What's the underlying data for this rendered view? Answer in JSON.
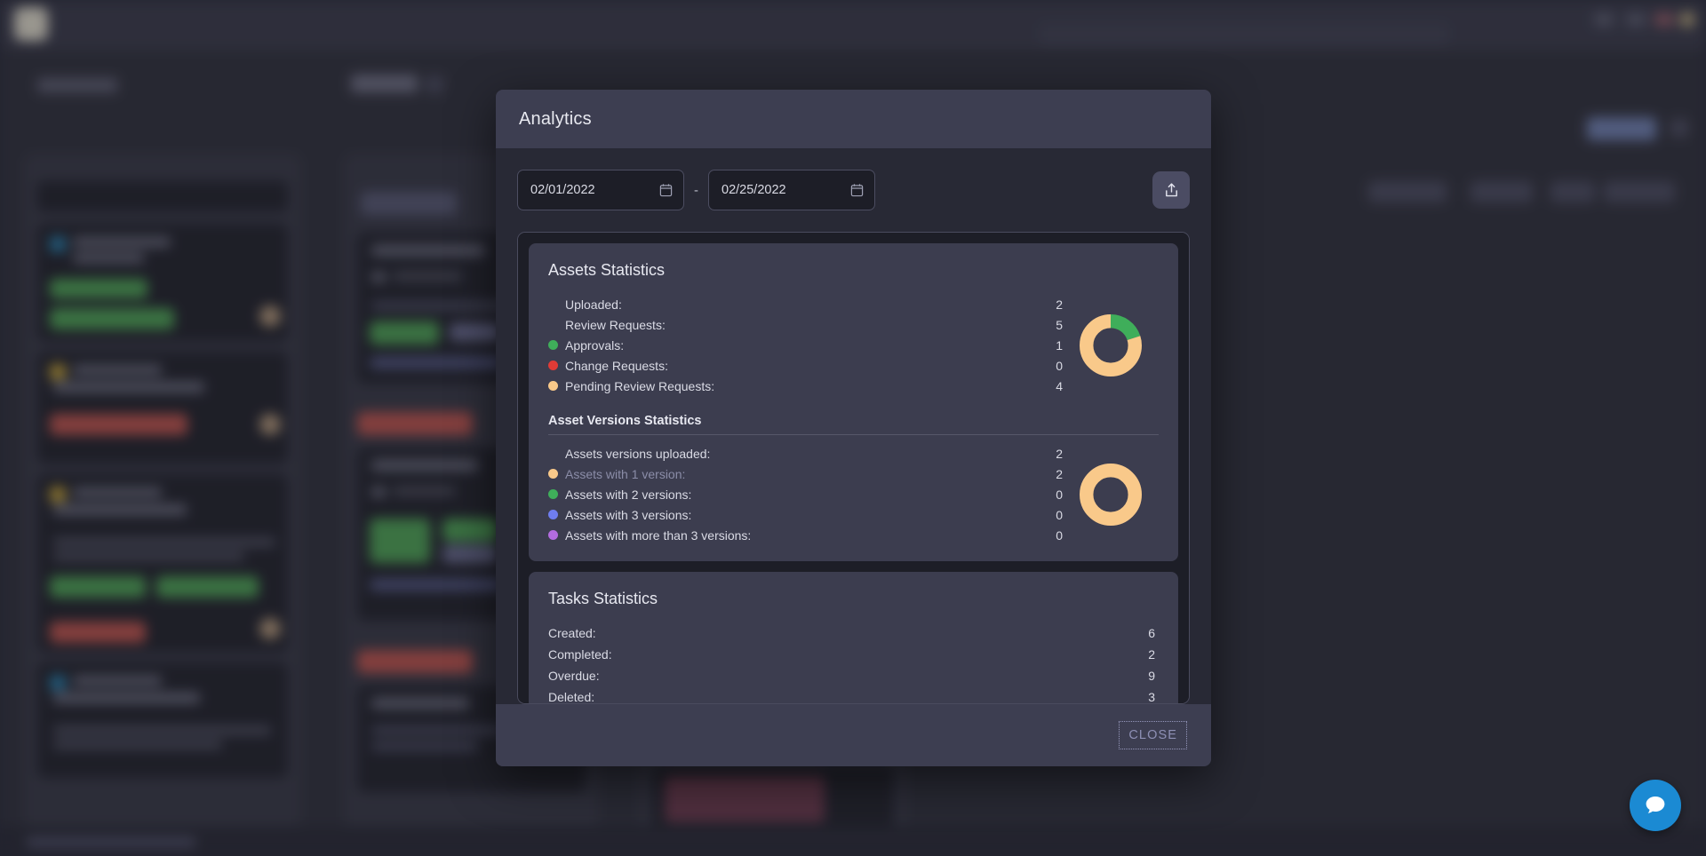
{
  "background": {
    "topbar": {
      "logo_icon": "app-logo-icon",
      "search_placeholder": ""
    },
    "chat_widget": {
      "icon": "chat-bubble-icon",
      "color": "#1b8ad3"
    }
  },
  "modal": {
    "title": "Analytics",
    "date_range": {
      "start_value": "02/01/2022",
      "start_placeholder": "mm/dd/yyyy",
      "end_value": "02/25/2022",
      "end_placeholder": "mm/dd/yyyy",
      "separator": "-",
      "calendar_icon": "calendar-icon"
    },
    "export_button": {
      "icon": "export-upload-icon",
      "color": "#4b4c63"
    },
    "footer": {
      "close_label": "CLOSE"
    }
  },
  "assets_statistics": {
    "title": "Assets Statistics",
    "rows": [
      {
        "label": "Uploaded:",
        "value": "2",
        "dot": null
      },
      {
        "label": "Review Requests:",
        "value": "5",
        "dot": null
      },
      {
        "label": "Approvals:",
        "value": "1",
        "dot": "#3fae5a"
      },
      {
        "label": "Change Requests:",
        "value": "0",
        "dot": "#e03b36"
      },
      {
        "label": "Pending Review Requests:",
        "value": "4",
        "dot": "#f9c98a"
      }
    ],
    "subsection": {
      "title": "Asset Versions Statistics",
      "rows": [
        {
          "label": "Assets versions uploaded:",
          "value": "2",
          "dot": null,
          "dim": false
        },
        {
          "label": "Assets with 1 version:",
          "value": "2",
          "dot": "#f9c98a",
          "dim": true
        },
        {
          "label": "Assets with 2 versions:",
          "value": "0",
          "dot": "#3fae5a",
          "dim": false
        },
        {
          "label": "Assets with 3 versions:",
          "value": "0",
          "dot": "#6f7df0",
          "dim": false
        },
        {
          "label": "Assets with more than 3 versions:",
          "value": "0",
          "dot": "#b36ce0",
          "dim": false
        }
      ]
    }
  },
  "tasks_statistics": {
    "title": "Tasks Statistics",
    "rows": [
      {
        "label": "Created:",
        "value": "6"
      },
      {
        "label": "Completed:",
        "value": "2"
      },
      {
        "label": "Overdue:",
        "value": "9"
      },
      {
        "label": "Deleted:",
        "value": "3"
      }
    ]
  },
  "chart_data": [
    {
      "type": "pie",
      "title": "Assets Statistics review requests breakdown",
      "labels": [
        "Approvals",
        "Change Requests",
        "Pending Review Requests"
      ],
      "values": [
        1,
        0,
        4
      ],
      "colors": [
        "#3fae5a",
        "#e03b36",
        "#f9c98a"
      ],
      "donut": true,
      "legend": "left"
    },
    {
      "type": "pie",
      "title": "Asset Versions Statistics breakdown",
      "labels": [
        "Assets with 1 version",
        "Assets with 2 versions",
        "Assets with 3 versions",
        "Assets with more than 3 versions"
      ],
      "values": [
        2,
        0,
        0,
        0
      ],
      "colors": [
        "#f9c98a",
        "#3fae5a",
        "#6f7df0",
        "#b36ce0"
      ],
      "donut": true,
      "legend": "left"
    }
  ]
}
